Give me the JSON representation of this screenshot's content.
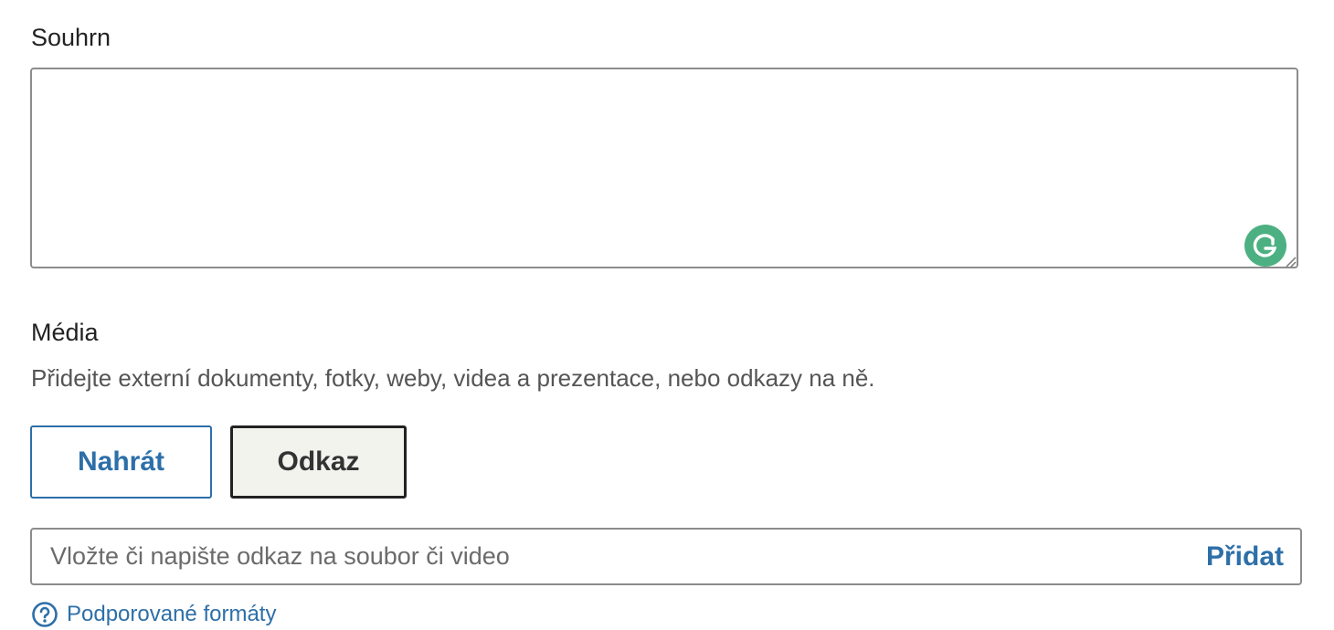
{
  "summary": {
    "label": "Souhrn",
    "value": ""
  },
  "media": {
    "label": "Média",
    "description": "Přidejte externí dokumenty, fotky, weby, videa a prezentace, nebo odkazy na ně.",
    "upload_button": "Nahrát",
    "link_button": "Odkaz"
  },
  "link_input": {
    "placeholder": "Vložte či napište odkaz na soubor či video",
    "value": "",
    "add_button": "Přidat"
  },
  "formats_link": {
    "label": "Podporované formáty",
    "icon": "question-circle-icon"
  },
  "colors": {
    "accent": "#2d6fa8",
    "grammarly": "#4db082",
    "border": "#8c8c8c"
  },
  "icons": {
    "grammarly": "grammarly-icon",
    "resize": "resize-handle-icon"
  }
}
